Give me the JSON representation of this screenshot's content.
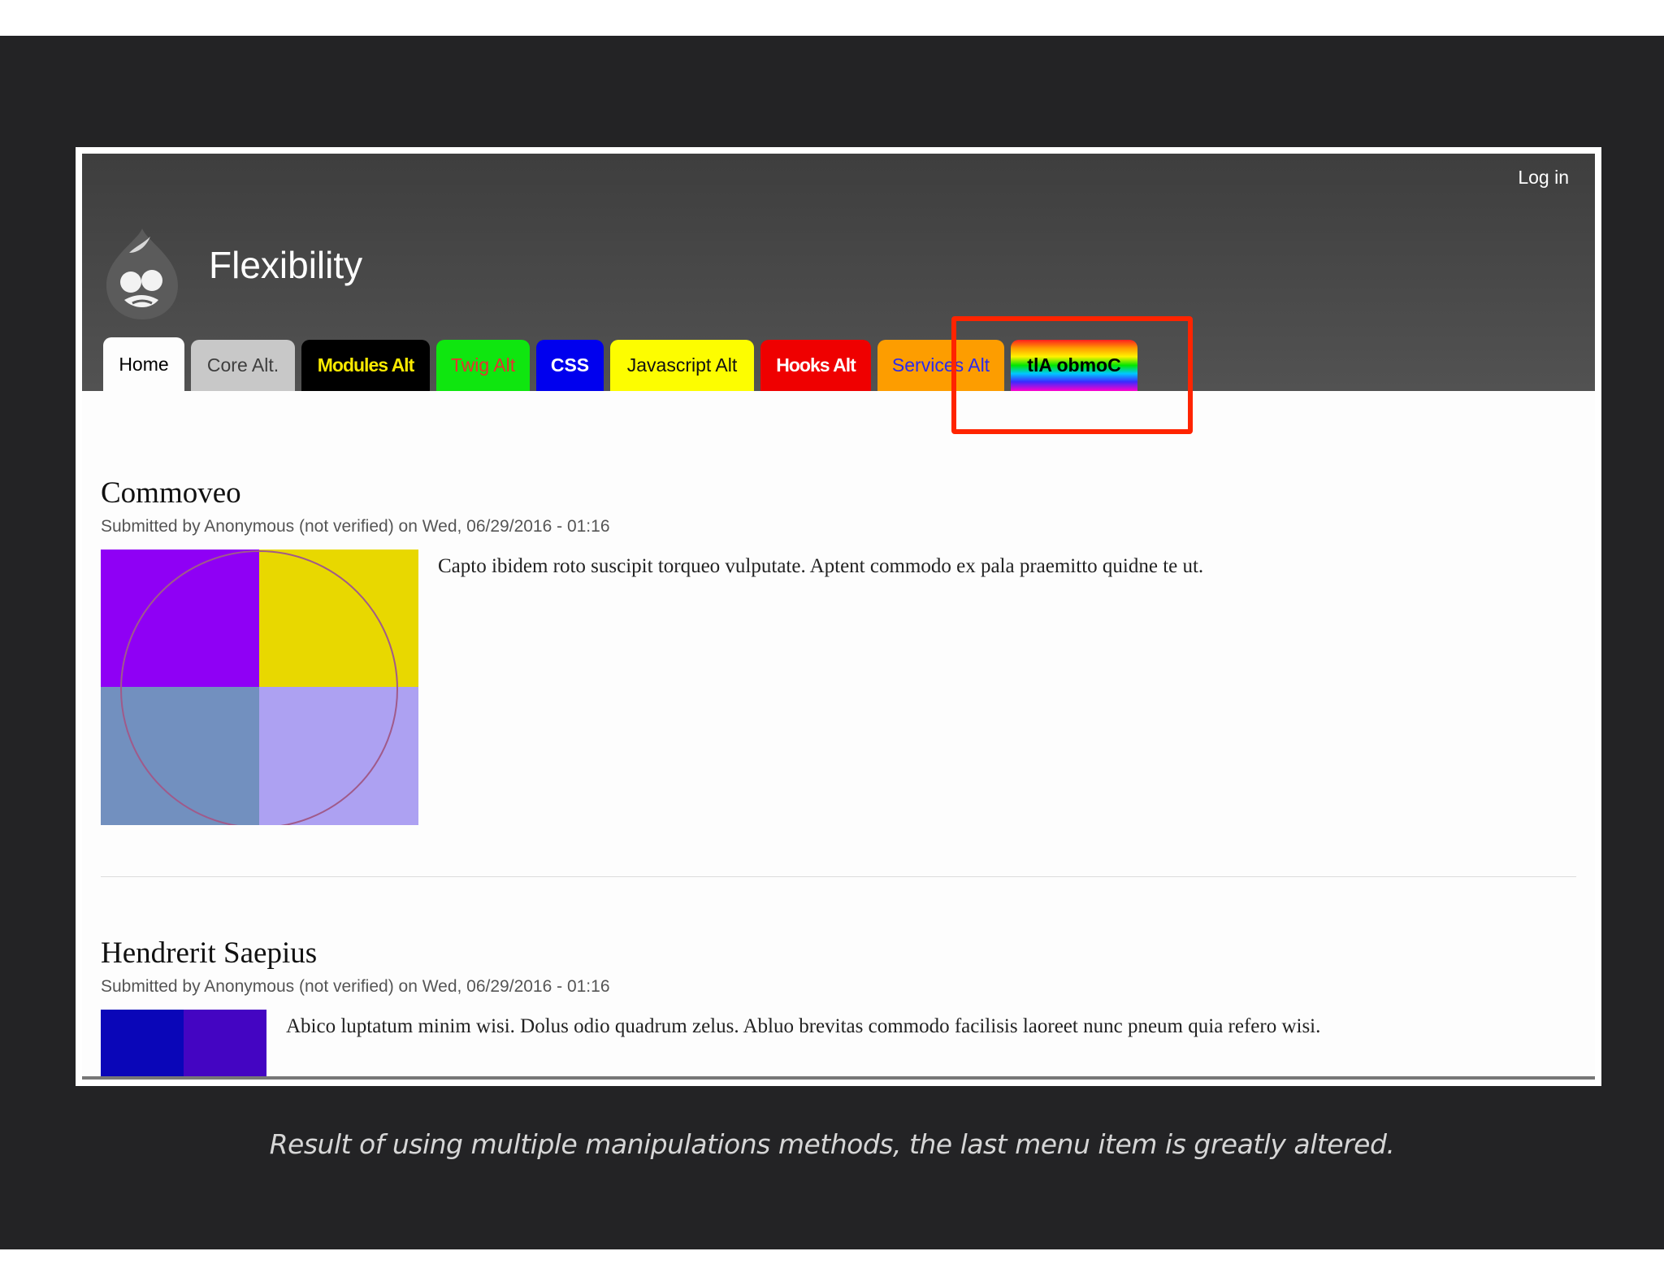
{
  "header": {
    "login": "Log in",
    "site_name": "Flexibility",
    "logo_icon": "drupal-drop-icon"
  },
  "tabs": [
    {
      "label": "Home"
    },
    {
      "label": "Core Alt."
    },
    {
      "label": "Modules Alt"
    },
    {
      "label": "Twig Alt"
    },
    {
      "label": "CSS"
    },
    {
      "label": "Javascript Alt"
    },
    {
      "label": "Hooks Alt"
    },
    {
      "label": "Services Alt"
    },
    {
      "label": "tlA obmoC"
    }
  ],
  "highlight_color": "#ff2400",
  "articles": [
    {
      "title": "Commoveo",
      "meta": "Submitted by Anonymous (not verified) on Wed, 06/29/2016 - 01:16",
      "body": "Capto ibidem roto suscipit torqueo vulputate. Aptent commodo ex pala praemitto quidne te ut.",
      "image_colors": [
        "#8f00f5",
        "#e8d800",
        "#7290bf",
        "#ada1f2"
      ]
    },
    {
      "title": "Hendrerit Saepius",
      "meta": "Submitted by Anonymous (not verified) on Wed, 06/29/2016 - 01:16",
      "body": "Abico luptatum minim wisi. Dolus odio quadrum zelus. Abluo brevitas commodo facilisis laoreet nunc pneum quia refero wisi.",
      "image_colors": [
        "#0a06b8",
        "#4405c2"
      ]
    }
  ],
  "caption": "Result of using multiple manipulations methods, the last menu item is greatly altered."
}
